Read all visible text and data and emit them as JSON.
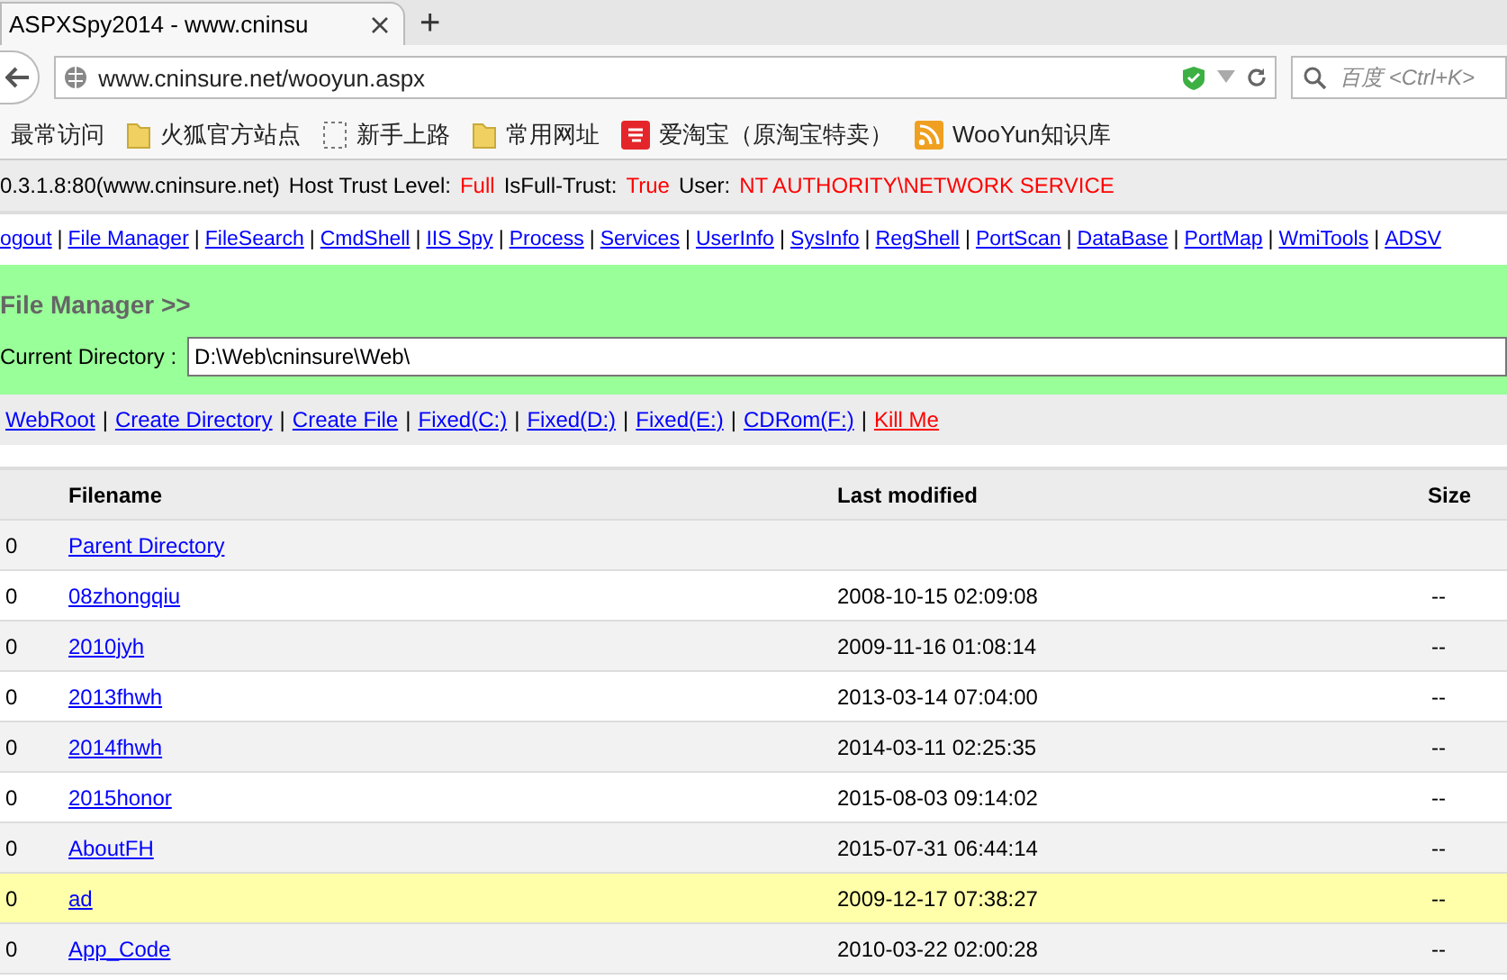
{
  "browser": {
    "tab": {
      "title": "ASPXSpy2014 - www.cninsu",
      "selected": true
    },
    "new_tab": "+",
    "address": "www.cninsure.net/wooyun.aspx",
    "search": {
      "placeholder": "百度 <Ctrl+K>"
    },
    "bookmarks": [
      {
        "label": "最常访问",
        "kind": "plain"
      },
      {
        "label": "火狐官方站点",
        "kind": "folder"
      },
      {
        "label": "新手上路",
        "kind": "dashed"
      },
      {
        "label": "常用网址",
        "kind": "folder"
      },
      {
        "label": "爱淘宝（原淘宝特卖）",
        "kind": "taobao"
      },
      {
        "label": "WooYun知识库",
        "kind": "rss"
      }
    ]
  },
  "info_line": [
    {
      "text": "0.3.1.8:80(www.cninsure.net)",
      "kind": "label"
    },
    {
      "text": "Host Trust Level:",
      "kind": "label"
    },
    {
      "text": "Full",
      "kind": "value"
    },
    {
      "text": "IsFull-Trust:",
      "kind": "label"
    },
    {
      "text": "True",
      "kind": "value"
    },
    {
      "text": "User:",
      "kind": "label"
    },
    {
      "text": "NT AUTHORITY\\NETWORK SERVICE",
      "kind": "value"
    }
  ],
  "nav": [
    {
      "kind": "link",
      "text": "ogout"
    },
    {
      "kind": "separator",
      "text": "|"
    },
    {
      "kind": "link",
      "text": "File Manager"
    },
    {
      "kind": "separator",
      "text": "|"
    },
    {
      "kind": "link",
      "text": "FileSearch"
    },
    {
      "kind": "separator",
      "text": "|"
    },
    {
      "kind": "link",
      "text": "CmdShell"
    },
    {
      "kind": "separator",
      "text": "|"
    },
    {
      "kind": "link",
      "text": "IIS Spy"
    },
    {
      "kind": "separator",
      "text": "|"
    },
    {
      "kind": "link",
      "text": "Process"
    },
    {
      "kind": "separator",
      "text": "|"
    },
    {
      "kind": "link",
      "text": "Services"
    },
    {
      "kind": "separator",
      "text": "|"
    },
    {
      "kind": "link",
      "text": "UserInfo"
    },
    {
      "kind": "separator",
      "text": "|"
    },
    {
      "kind": "link",
      "text": "SysInfo"
    },
    {
      "kind": "separator",
      "text": "|"
    },
    {
      "kind": "link",
      "text": "RegShell"
    },
    {
      "kind": "separator",
      "text": "|"
    },
    {
      "kind": "link",
      "text": "PortScan"
    },
    {
      "kind": "separator",
      "text": "|"
    },
    {
      "kind": "link",
      "text": "DataBase"
    },
    {
      "kind": "separator",
      "text": "|"
    },
    {
      "kind": "link",
      "text": "PortMap"
    },
    {
      "kind": "separator",
      "text": "|"
    },
    {
      "kind": "link",
      "text": "WmiTools"
    },
    {
      "kind": "separator",
      "text": "|"
    },
    {
      "kind": "link",
      "text": "ADSV"
    }
  ],
  "panel": {
    "title": "File Manager >>",
    "directory_label": "Current Directory :",
    "directory_value": "D:\\Web\\cninsure\\Web\\"
  },
  "tools": [
    {
      "kind": "link",
      "text": "WebRoot"
    },
    {
      "kind": "separator",
      "text": "|"
    },
    {
      "kind": "link",
      "text": "Create Directory"
    },
    {
      "kind": "separator",
      "text": "|"
    },
    {
      "kind": "link",
      "text": "Create File"
    },
    {
      "kind": "separator",
      "text": "|"
    },
    {
      "kind": "link",
      "text": "Fixed(C:)"
    },
    {
      "kind": "separator",
      "text": "|"
    },
    {
      "kind": "link",
      "text": "Fixed(D:)"
    },
    {
      "kind": "separator",
      "text": "|"
    },
    {
      "kind": "link",
      "text": "Fixed(E:)"
    },
    {
      "kind": "separator",
      "text": "|"
    },
    {
      "kind": "link",
      "text": "CDRom(F:)"
    },
    {
      "kind": "separator",
      "text": "|"
    },
    {
      "kind": "danger-link",
      "text": "Kill Me"
    }
  ],
  "table": {
    "columns": [
      "Filename",
      "Last modified",
      "Size"
    ],
    "rows": [
      {
        "mark": "0",
        "name": "Parent Directory",
        "modified": "",
        "size": "",
        "highlighted": false
      },
      {
        "mark": "0",
        "name": "08zhongqiu",
        "modified": "2008-10-15 02:09:08",
        "size": "--",
        "highlighted": false
      },
      {
        "mark": "0",
        "name": "2010jyh",
        "modified": "2009-11-16 01:08:14",
        "size": "--",
        "highlighted": false
      },
      {
        "mark": "0",
        "name": "2013fhwh",
        "modified": "2013-03-14 07:04:00",
        "size": "--",
        "highlighted": false
      },
      {
        "mark": "0",
        "name": "2014fhwh",
        "modified": "2014-03-11 02:25:35",
        "size": "--",
        "highlighted": false
      },
      {
        "mark": "0",
        "name": "2015honor",
        "modified": "2015-08-03 09:14:02",
        "size": "--",
        "highlighted": false
      },
      {
        "mark": "0",
        "name": "AboutFH",
        "modified": "2015-07-31 06:44:14",
        "size": "--",
        "highlighted": false
      },
      {
        "mark": "0",
        "name": "ad",
        "modified": "2009-12-17 07:38:27",
        "size": "--",
        "highlighted": true
      },
      {
        "mark": "0",
        "name": "App_Code",
        "modified": "2010-03-22 02:00:28",
        "size": "--",
        "highlighted": false
      }
    ]
  }
}
